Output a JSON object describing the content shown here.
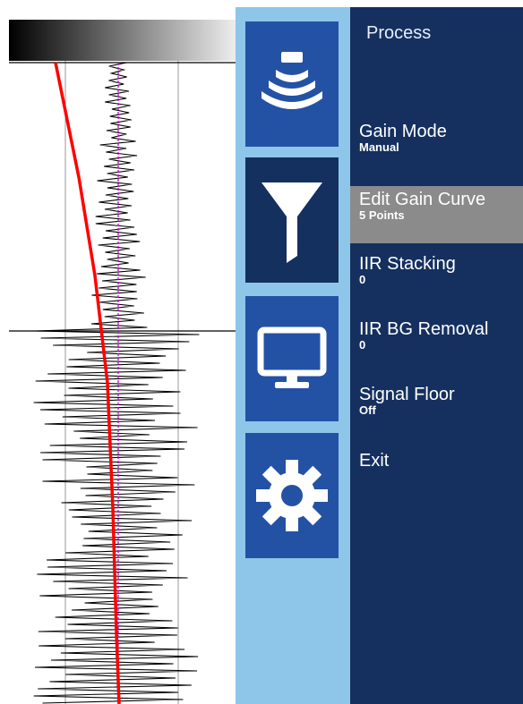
{
  "menu": {
    "title": "Process",
    "items": [
      {
        "label": "Gain Mode",
        "value": "Manual"
      },
      {
        "label": "Edit Gain Curve",
        "value": "5 Points",
        "selected": true
      },
      {
        "label": "IIR Stacking",
        "value": "0"
      },
      {
        "label": "IIR BG Removal",
        "value": "0"
      },
      {
        "label": "Signal Floor",
        "value": "Off"
      },
      {
        "label": "Exit",
        "value": ""
      }
    ]
  },
  "icons": {
    "transducer": "transducer-waves-icon",
    "filter": "filter-funnel-icon",
    "display": "monitor-icon",
    "settings": "gear-icon"
  },
  "colors": {
    "menu_bg": "#15305f",
    "selected_item": "#8b8b8b",
    "tile_active": "#2352a5",
    "tile_selected": "#14305f",
    "icon_column_bg": "#8ec6ea",
    "gain_curve": "#ff0000",
    "marker_line": "#cc00cc"
  }
}
